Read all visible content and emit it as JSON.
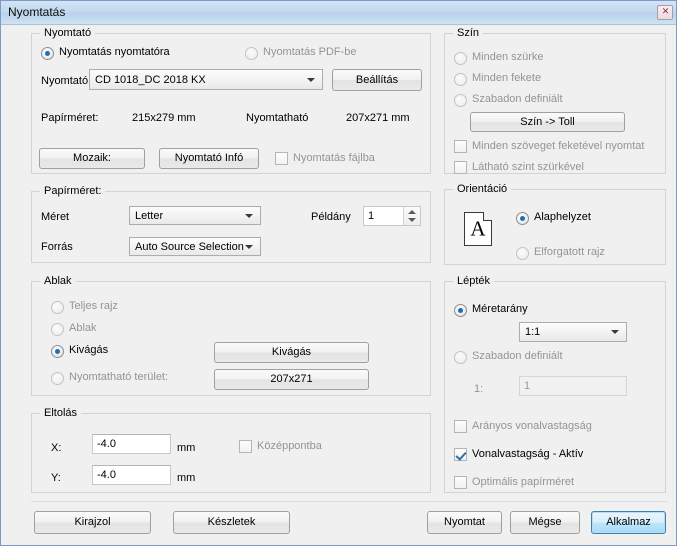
{
  "window": {
    "title": "Nyomtatás",
    "close_icon": "close-icon",
    "close_glyph": "✕"
  },
  "printer_group": {
    "legend": "Nyomtató",
    "radio_to_printer": "Nyomtatás nyomtatóra",
    "radio_to_pdf": "Nyomtatás PDF-be",
    "printer_label": "Nyomtató",
    "printer_value": "CD 1018_DC 2018 KX",
    "settings_button": "Beállítás",
    "papersize_label": "Papírméret:",
    "papersize_value": "215x279 mm",
    "printable_label": "Nyomtatható",
    "printable_value": "207x271 mm",
    "mosaic_button": "Mozaik:",
    "printer_info_button": "Nyomtató Infó",
    "print_to_file_check": "Nyomtatás fájlba"
  },
  "paper_group": {
    "legend": "Papírméret:",
    "size_label": "Méret",
    "size_value": "Letter",
    "source_label": "Forrás",
    "source_value": "Auto Source Selection",
    "copies_label": "Példány",
    "copies_value": "1"
  },
  "window_group": {
    "legend": "Ablak",
    "radio_full_drawing": "Teljes rajz",
    "radio_window": "Ablak",
    "radio_crop": "Kivágás",
    "radio_printable_area": "Nyomtatható terület:",
    "crop_button": "Kivágás",
    "printable_button": "207x271"
  },
  "offset_group": {
    "legend": "Eltolás",
    "x_label": "X:",
    "x_value": "-4.0",
    "x_unit": "mm",
    "y_label": "Y:",
    "y_value": "-4.0",
    "y_unit": "mm",
    "center_check": "Középpontba"
  },
  "color_group": {
    "legend": "Szín",
    "radio_all_gray": "Minden szürke",
    "radio_all_black": "Minden fekete",
    "radio_custom": "Szabadon definiált",
    "color_to_pen_button": "Szín -> Toll",
    "check_all_text_black": "Minden szöveget feketével nyomtat",
    "check_visible_level_gray": "Látható szint szürkével"
  },
  "orientation_group": {
    "legend": "Orientáció",
    "icon_letter": "A",
    "radio_default": "Alaphelyzet",
    "radio_rotated": "Elforgatott rajz"
  },
  "scale_group": {
    "legend": "Lépték",
    "radio_ratio": "Méretarány",
    "ratio_value": "1:1",
    "radio_custom": "Szabadon definiált",
    "custom_label": "1:",
    "custom_value": "1",
    "check_proportional_linewidth": "Arányos vonalvastagság",
    "check_linewidth_active": "Vonalvastagság - Aktív",
    "check_optimal_papersize": "Optimális papírméret"
  },
  "footer": {
    "draw_button": "Kirajzol",
    "presets_button": "Készletek",
    "print_button": "Nyomtat",
    "cancel_button": "Mégse",
    "apply_button": "Alkalmaz"
  },
  "colors": {
    "accent": "#1f6fb4",
    "default_button_border": "#3c7fb1",
    "dialog_bg": "#f0f0f0",
    "titlebar": "#c2d9ef"
  }
}
